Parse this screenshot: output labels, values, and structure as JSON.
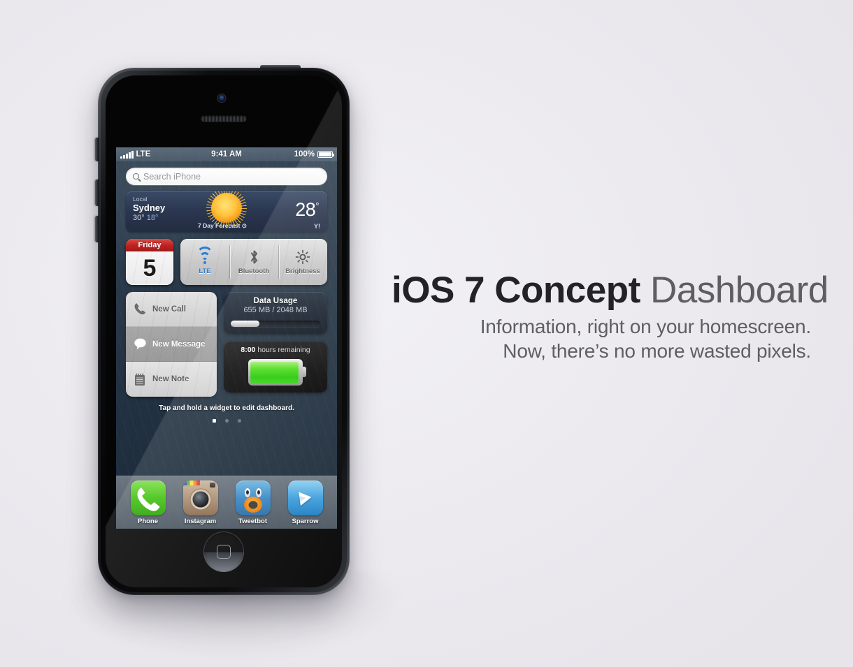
{
  "marketing": {
    "headline_bold": "iOS 7 Concept",
    "headline_light": " Dashboard",
    "subtitle_line1": "Information, right on your homescreen.",
    "subtitle_line2": "Now, there’s no more wasted pixels."
  },
  "status_bar": {
    "carrier": "LTE",
    "time": "9:41 AM",
    "battery_percent": "100%"
  },
  "search": {
    "placeholder": "Search iPhone"
  },
  "weather": {
    "label": "Local",
    "city": "Sydney",
    "high": "30°",
    "low": "18°",
    "temp": "28",
    "degree": "°",
    "forecast": "7 Day Forecast ⊙",
    "provider": "Y!"
  },
  "calendar": {
    "weekday": "Friday",
    "day": "5"
  },
  "toggles": [
    {
      "label": "LTE",
      "icon": "wifi-icon",
      "active": true
    },
    {
      "label": "Bluetooth",
      "icon": "bluetooth-icon",
      "active": false
    },
    {
      "label": "Brightness",
      "icon": "brightness-icon",
      "active": false
    }
  ],
  "actions": [
    {
      "label": "New Call",
      "icon": "phone-handset-icon",
      "pressed": false
    },
    {
      "label": "New Message",
      "icon": "speech-bubble-icon",
      "pressed": true
    },
    {
      "label": "New Note",
      "icon": "notepad-icon",
      "pressed": false
    }
  ],
  "data_usage": {
    "title": "Data Usage",
    "value": "655 MB / 2048 MB",
    "used_mb": 655,
    "total_mb": 2048,
    "fill_percent": 32
  },
  "battery_widget": {
    "hours": "8:00",
    "label": "hours remaining",
    "fill_percent": 96,
    "color": "#35cf10"
  },
  "hint": "Tap and hold a widget to edit dashboard.",
  "page_dots": {
    "count": 3,
    "active_index": 0
  },
  "dock": [
    {
      "label": "Phone",
      "icon": "phone-app-icon"
    },
    {
      "label": "Instagram",
      "icon": "instagram-app-icon"
    },
    {
      "label": "Tweetbot",
      "icon": "tweetbot-app-icon"
    },
    {
      "label": "Sparrow",
      "icon": "sparrow-app-icon"
    }
  ],
  "colors": {
    "page_background": "#ecebef",
    "accent_blue": "#2a7fd4",
    "wallpaper": "#2a3b4a",
    "calendar_red": "#bd2222"
  }
}
